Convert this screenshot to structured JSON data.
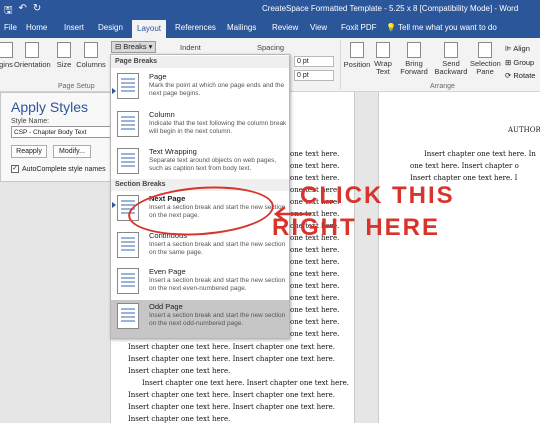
{
  "window": {
    "title": "CreateSpace Formatted Template - 5.25 x 8 [Compatibility Mode] - Word"
  },
  "tabs": [
    "File",
    "Home",
    "Insert",
    "Design",
    "Layout",
    "References",
    "Mailings",
    "Review",
    "View",
    "Foxit PDF"
  ],
  "active_tab": "Layout",
  "tell_me": "Tell me what you want to do",
  "ribbon": {
    "margins": "gins",
    "orientation": "Orientation",
    "size": "Size",
    "columns": "Columns",
    "breaks": "Breaks",
    "indent": "Indent",
    "spacing": "Spacing",
    "spacing_before": "0 pt",
    "spacing_after": "0 pt",
    "position": "Position",
    "wrap_text": "Wrap Text",
    "bring_forward": "Bring Forward",
    "send_backward": "Send Backward",
    "selection_pane": "Selection Pane",
    "align": "Align",
    "group": "Group",
    "rotate": "Rotate",
    "page_setup_label": "Page Setup",
    "arrange_label": "Arrange"
  },
  "apply_styles": {
    "heading": "Apply Styles",
    "style_name_label": "Style Name:",
    "style_name_value": "CSP - Chapter Body Text",
    "reapply": "Reapply",
    "modify": "Modify...",
    "autocomplete": "AutoComplete style names"
  },
  "breaks_menu": {
    "page_breaks_header": "Page Breaks",
    "section_breaks_header": "Section Breaks",
    "items": [
      {
        "title": "Page",
        "desc": "Mark the point at which one page ends and the next page begins."
      },
      {
        "title": "Column",
        "desc": "Indicate that the text following the column break will begin in the next column."
      },
      {
        "title": "Text Wrapping",
        "desc": "Separate text around objects on web pages, such as caption text from body text."
      },
      {
        "title": "Next Page",
        "desc": "Insert a section break and start the new section on the next page."
      },
      {
        "title": "Continuous",
        "desc": "Insert a section break and start the new section on the same page."
      },
      {
        "title": "Even Page",
        "desc": "Insert a section break and start the new section on the next even-numbered page."
      },
      {
        "title": "Odd Page",
        "desc": "Insert a section break and start the new section on the next odd-numbered page."
      }
    ]
  },
  "annotation": {
    "line1": "CLICK THIS",
    "line2": "RIGHT HERE"
  },
  "document": {
    "header_right": "AUTHOR I",
    "line_short": "one text here.",
    "line_full": "Insert chapter one text here. Insert chapter one text here.",
    "line_page2_a": "Insert chapter one text here. In",
    "line_page2_b": "one text here. Insert chapter o",
    "line_page2_c": "Insert chapter one text here. I",
    "line_last": "Insert chapter one text here."
  }
}
